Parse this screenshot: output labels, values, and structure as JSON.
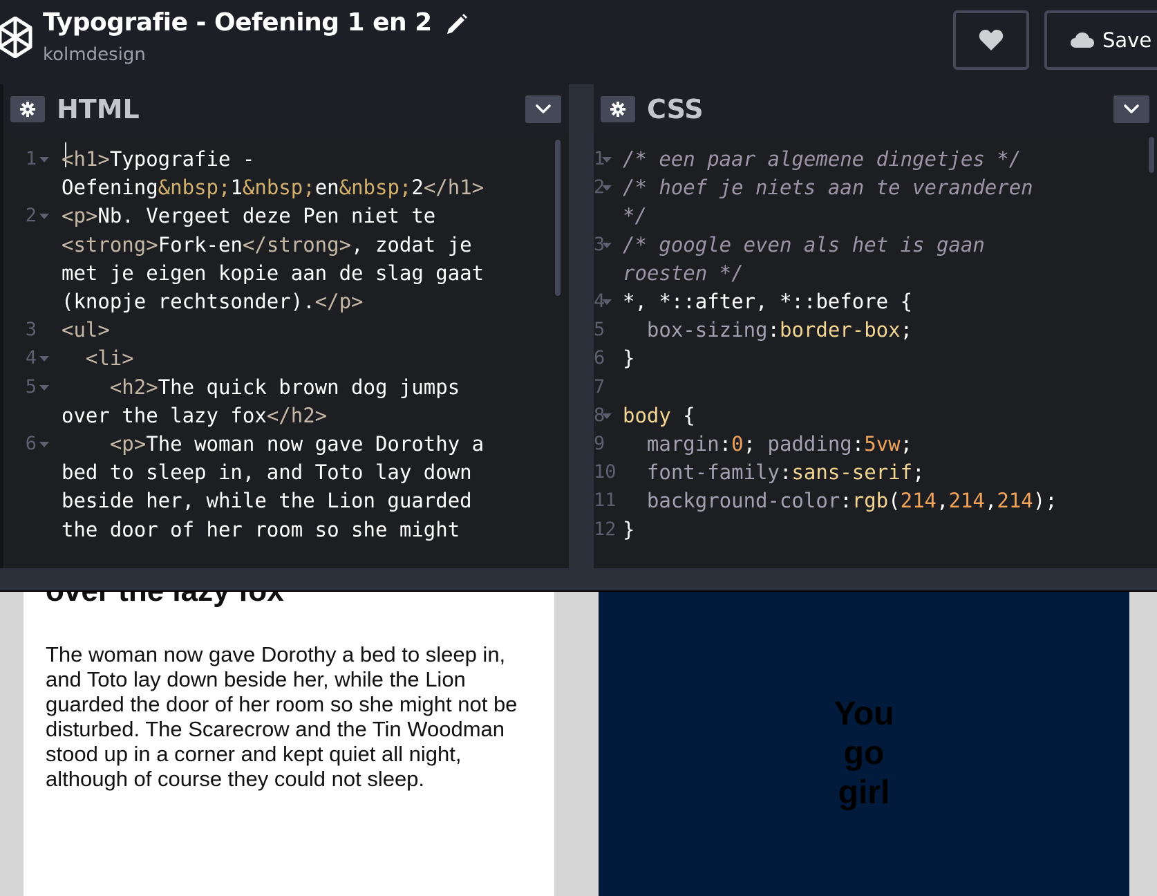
{
  "header": {
    "title": "Typografie - Oefening 1 en 2",
    "owner": "kolmdesign",
    "heart_icon": "heart-icon",
    "save_label": "Save"
  },
  "html_editor": {
    "title": "HTML",
    "lines": [
      {
        "n": "1",
        "fold": true,
        "segs": [
          [
            "tag",
            "<h1>"
          ],
          [
            "txt",
            "Typografie -"
          ]
        ]
      },
      {
        "n": "",
        "fold": false,
        "segs": [
          [
            "txt",
            "Oefening"
          ],
          [
            "ent",
            "&nbsp;"
          ],
          [
            "txt",
            "1"
          ],
          [
            "ent",
            "&nbsp;"
          ],
          [
            "txt",
            "en"
          ],
          [
            "ent",
            "&nbsp;"
          ],
          [
            "txt",
            "2"
          ],
          [
            "tag",
            "</h1>"
          ]
        ]
      },
      {
        "n": "2",
        "fold": true,
        "segs": [
          [
            "tag",
            "<p>"
          ],
          [
            "txt",
            "Nb. Vergeet deze Pen niet te"
          ]
        ]
      },
      {
        "n": "",
        "fold": false,
        "segs": [
          [
            "tag",
            "<strong>"
          ],
          [
            "txt",
            "Fork-en"
          ],
          [
            "tag",
            "</strong>"
          ],
          [
            "txt",
            ", zodat je"
          ]
        ]
      },
      {
        "n": "",
        "fold": false,
        "segs": [
          [
            "txt",
            "met je eigen kopie aan de slag gaat"
          ]
        ]
      },
      {
        "n": "",
        "fold": false,
        "segs": [
          [
            "txt",
            "(knopje rechtsonder)."
          ],
          [
            "tag",
            "</p>"
          ]
        ]
      },
      {
        "n": "3",
        "fold": false,
        "segs": [
          [
            "tag",
            "<ul>"
          ]
        ]
      },
      {
        "n": "4",
        "fold": true,
        "segs": [
          [
            "txt",
            "  "
          ],
          [
            "tag",
            "<li>"
          ]
        ]
      },
      {
        "n": "5",
        "fold": true,
        "segs": [
          [
            "txt",
            "    "
          ],
          [
            "tag",
            "<h2>"
          ],
          [
            "txt",
            "The quick brown dog jumps"
          ]
        ]
      },
      {
        "n": "",
        "fold": false,
        "segs": [
          [
            "txt",
            "over the lazy fox"
          ],
          [
            "tag",
            "</h2>"
          ]
        ]
      },
      {
        "n": "6",
        "fold": true,
        "segs": [
          [
            "txt",
            "    "
          ],
          [
            "tag",
            "<p>"
          ],
          [
            "txt",
            "The woman now gave Dorothy a"
          ]
        ]
      },
      {
        "n": "",
        "fold": false,
        "segs": [
          [
            "txt",
            "bed to sleep in, and Toto lay down"
          ]
        ]
      },
      {
        "n": "",
        "fold": false,
        "segs": [
          [
            "txt",
            "beside her, while the Lion guarded"
          ]
        ]
      },
      {
        "n": "",
        "fold": false,
        "segs": [
          [
            "txt",
            "the door of her room so she might"
          ]
        ]
      }
    ]
  },
  "css_editor": {
    "title": "CSS",
    "lines": [
      {
        "n": "1",
        "fold": true,
        "segs": [
          [
            "com",
            "/* een paar algemene dingetjes */"
          ]
        ]
      },
      {
        "n": "2",
        "fold": true,
        "segs": [
          [
            "com",
            "/* hoef je niets aan te veranderen"
          ]
        ]
      },
      {
        "n": "",
        "fold": false,
        "segs": [
          [
            "com",
            "*/"
          ]
        ]
      },
      {
        "n": "3",
        "fold": true,
        "segs": [
          [
            "com",
            "/* google even als het is gaan"
          ]
        ]
      },
      {
        "n": "",
        "fold": false,
        "segs": [
          [
            "com",
            "roesten */"
          ]
        ]
      },
      {
        "n": "4",
        "fold": true,
        "segs": [
          [
            "txt",
            "*, *::after, *::before {"
          ]
        ]
      },
      {
        "n": "5",
        "fold": false,
        "segs": [
          [
            "txt",
            "  "
          ],
          [
            "prop",
            "box-sizing"
          ],
          [
            "txt",
            ":"
          ],
          [
            "val",
            "border-box"
          ],
          [
            "txt",
            ";"
          ]
        ]
      },
      {
        "n": "6",
        "fold": false,
        "segs": [
          [
            "txt",
            "}"
          ]
        ]
      },
      {
        "n": "7",
        "fold": false,
        "segs": []
      },
      {
        "n": "8",
        "fold": true,
        "segs": [
          [
            "sel",
            "body"
          ],
          [
            "txt",
            " {"
          ]
        ]
      },
      {
        "n": "9",
        "fold": false,
        "segs": [
          [
            "txt",
            "  "
          ],
          [
            "prop",
            "margin"
          ],
          [
            "txt",
            ":"
          ],
          [
            "num",
            "0"
          ],
          [
            "txt",
            "; "
          ],
          [
            "prop",
            "padding"
          ],
          [
            "txt",
            ":"
          ],
          [
            "num",
            "5vw"
          ],
          [
            "txt",
            ";"
          ]
        ]
      },
      {
        "n": "10",
        "fold": false,
        "segs": [
          [
            "txt",
            "  "
          ],
          [
            "prop",
            "font-family"
          ],
          [
            "txt",
            ":"
          ],
          [
            "val",
            "sans-serif"
          ],
          [
            "txt",
            ";"
          ]
        ]
      },
      {
        "n": "11",
        "fold": false,
        "segs": [
          [
            "txt",
            "  "
          ],
          [
            "prop",
            "background-color"
          ],
          [
            "txt",
            ":"
          ],
          [
            "val",
            "rgb"
          ],
          [
            "txt",
            "("
          ],
          [
            "num",
            "214"
          ],
          [
            "txt",
            ","
          ],
          [
            "num",
            "214"
          ],
          [
            "txt",
            ","
          ],
          [
            "num",
            "214"
          ],
          [
            "txt",
            ");"
          ]
        ]
      },
      {
        "n": "12",
        "fold": false,
        "segs": [
          [
            "txt",
            "}"
          ]
        ]
      }
    ]
  },
  "preview": {
    "heading": "over the lazy fox",
    "paragraph": "The woman now gave Dorothy a bed to sleep in, and Toto lay down beside her, while the Lion guarded the door of her room so she might not be disturbed. The Scarecrow and the Tin Woodman stood up in a corner and kept quiet all night, although of course they could not sleep.",
    "slogan": [
      "You",
      "go",
      "girl"
    ]
  },
  "colors": {
    "topbar_bg": "#1e1f26",
    "editor_bg": "#1d1e22",
    "tag": "#c5b8a6",
    "entity": "#d2b16c",
    "comment": "#9d94a8",
    "property": "#a59fb2",
    "value": "#f3d691",
    "number": "#f0a35a",
    "preview_bg": "#d6d6d6",
    "dark_card": "#021a3b"
  }
}
